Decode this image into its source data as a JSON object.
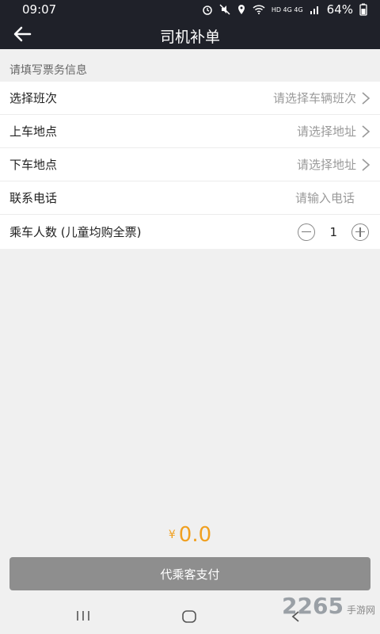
{
  "status_bar": {
    "time": "09:07",
    "network_label": "HD 4G 4G",
    "battery": "64%"
  },
  "header": {
    "title": "司机补单"
  },
  "section": {
    "label": "请填写票务信息"
  },
  "form": {
    "rows": [
      {
        "label": "选择班次",
        "value": "请选择车辆班次"
      },
      {
        "label": "上车地点",
        "value": "请选择地址"
      },
      {
        "label": "下车地点",
        "value": "请选择地址"
      },
      {
        "label": "联系电话",
        "placeholder": "请输入电话"
      },
      {
        "label": "乘车人数 (儿童均购全票)",
        "quantity": "1"
      }
    ]
  },
  "total": {
    "currency": "¥",
    "amount": "0.0"
  },
  "pay_button": {
    "label": "代乘客支付"
  },
  "watermark": {
    "main": "2265",
    "sub": "手游网"
  },
  "colors": {
    "header_bg": "#1f2129",
    "accent_price": "#f0a020",
    "button_bg": "#8e8e8e"
  }
}
